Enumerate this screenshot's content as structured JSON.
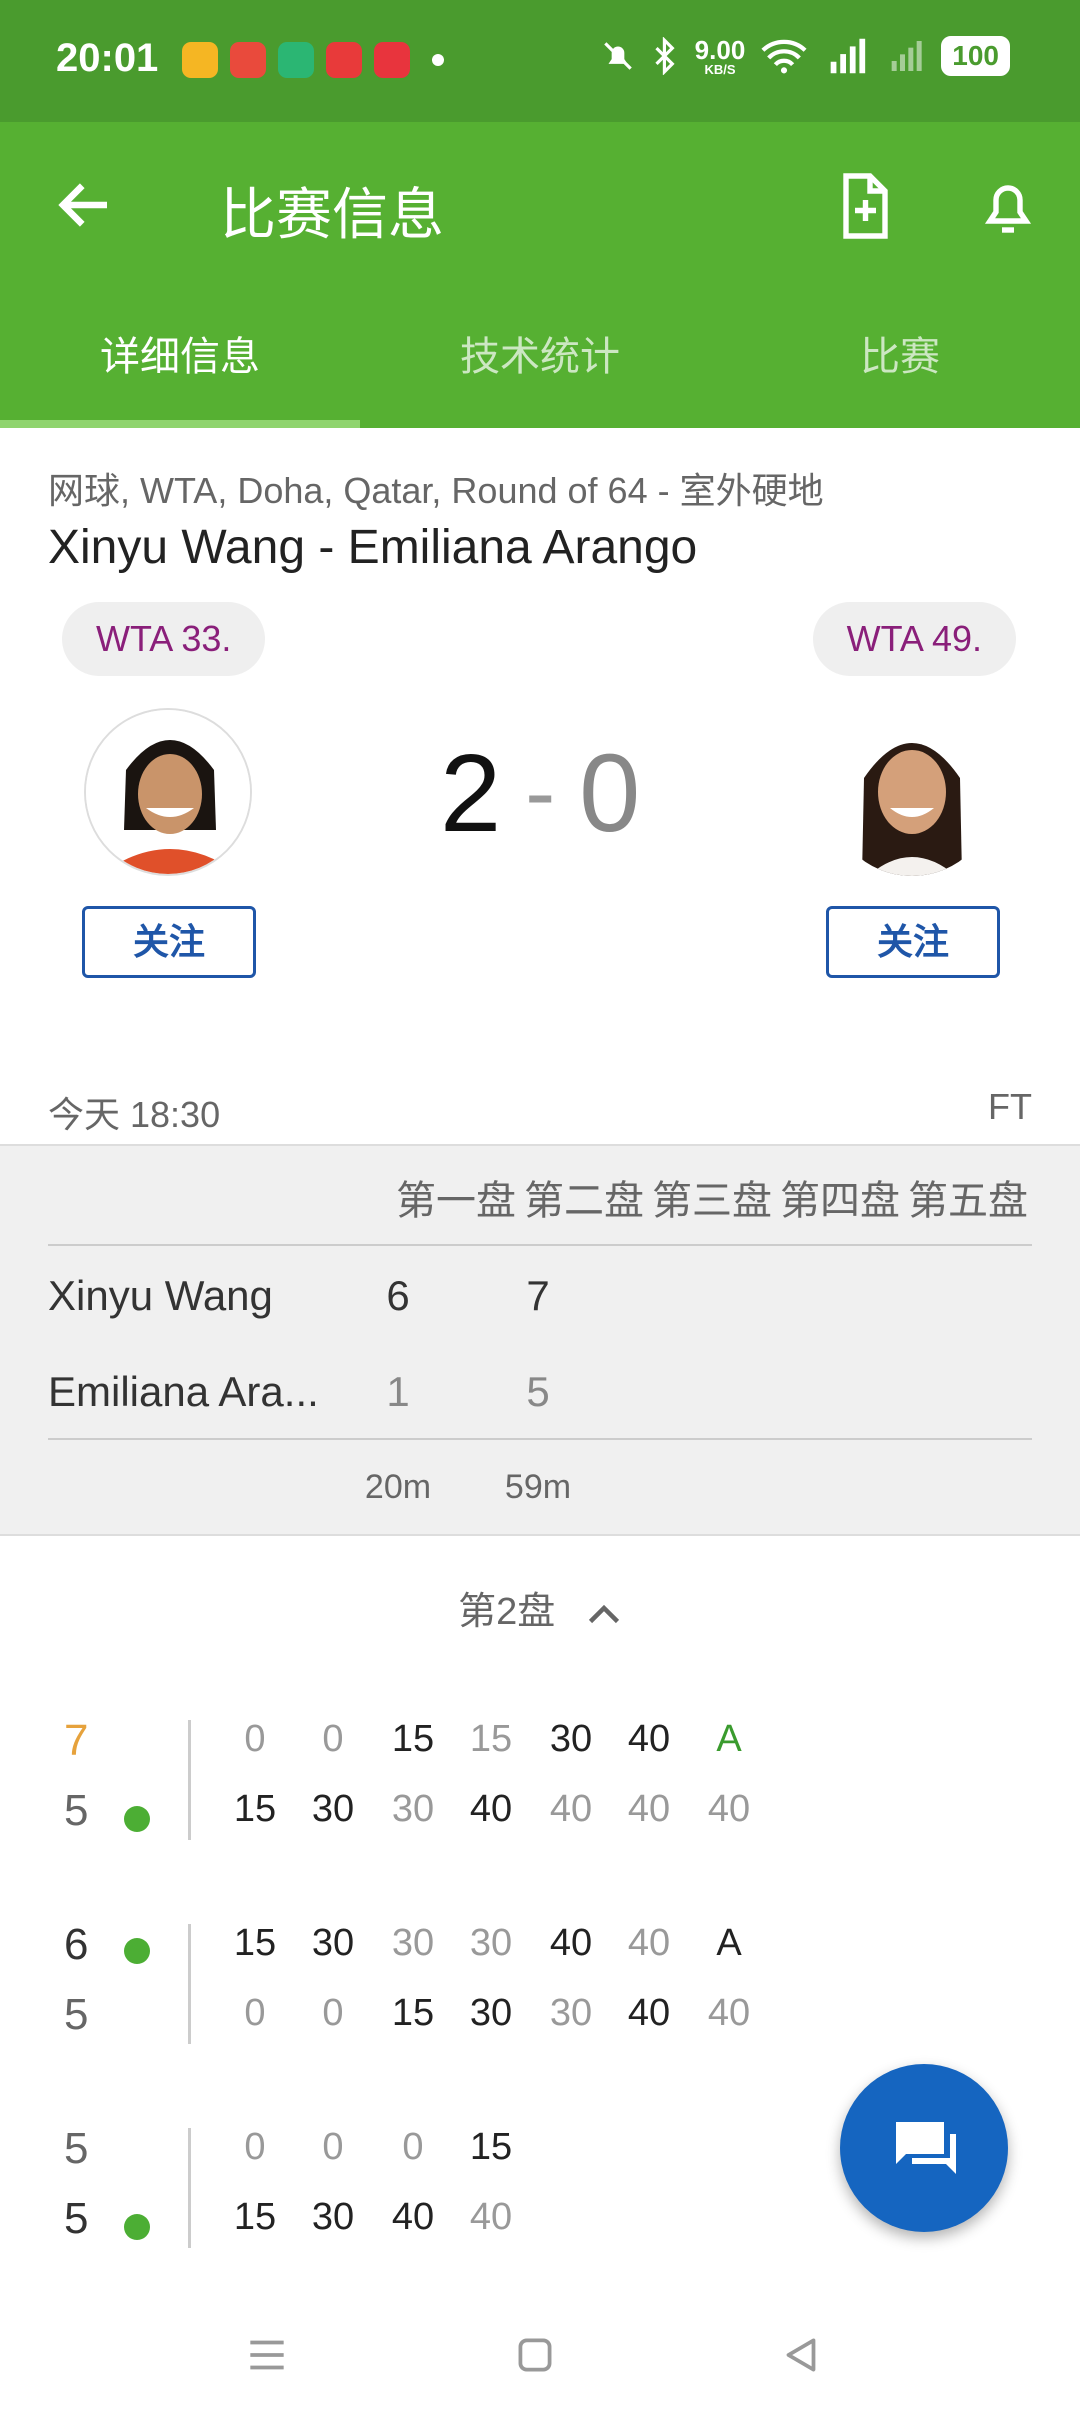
{
  "status_bar": {
    "time": "20:01",
    "net_speed_value": "9.00",
    "net_speed_unit": "KB/S",
    "battery": "100",
    "colors": {
      "bg": "#4a9b2e"
    }
  },
  "app_bar": {
    "title": "比赛信息",
    "back_icon": "arrow-left-icon",
    "add_doc_icon": "document-add-icon",
    "bell_icon": "bell-icon"
  },
  "tabs": [
    {
      "label": "详细信息",
      "active": true
    },
    {
      "label": "技术统计",
      "active": false
    },
    {
      "label": "比赛",
      "active": false
    }
  ],
  "match": {
    "meta": "网球, WTA, Doha, Qatar, Round of 64 - 室外硬地",
    "title": "Xinyu Wang - Emiliana Arango",
    "home": {
      "rank": "WTA 33.",
      "follow": "关注",
      "sets_won": "2"
    },
    "away": {
      "rank": "WTA 49.",
      "follow": "关注",
      "sets_won": "0"
    },
    "score_sep": "-",
    "time": "今天 18:30",
    "status": "FT"
  },
  "sets_table": {
    "headers": [
      "第一盘",
      "第二盘",
      "第三盘",
      "第四盘",
      "第五盘"
    ],
    "rows": [
      {
        "name": "Xinyu Wang",
        "sets": [
          "6",
          "7"
        ]
      },
      {
        "name": "Emiliana Ara...",
        "sets": [
          "1",
          "5"
        ]
      }
    ],
    "durations": [
      "20m",
      "59m"
    ]
  },
  "set_detail": {
    "title": "第2盘",
    "games": [
      {
        "top": {
          "score": "7",
          "points": [
            "0",
            "0",
            "15",
            "15",
            "30",
            "40",
            "A"
          ]
        },
        "bottom": {
          "score": "5",
          "points": [
            "15",
            "30",
            "30",
            "40",
            "40",
            "40",
            "40"
          ]
        }
      },
      {
        "top": {
          "score": "6",
          "points": [
            "15",
            "30",
            "30",
            "30",
            "40",
            "40",
            "A"
          ]
        },
        "bottom": {
          "score": "5",
          "points": [
            "0",
            "0",
            "15",
            "30",
            "30",
            "40",
            "40"
          ]
        }
      },
      {
        "top": {
          "score": "5",
          "points": [
            "0",
            "0",
            "0",
            "15"
          ]
        },
        "bottom": {
          "score": "5",
          "points": [
            "15",
            "30",
            "40",
            "40"
          ]
        }
      }
    ]
  },
  "fab_icon": "chat-icon",
  "nav": {
    "menu_icon": "menu-icon",
    "home_icon": "home-icon",
    "back_icon": "back-triangle-icon"
  },
  "colors": {
    "primary_green": "#56b032",
    "rank_text": "#8a1f7a",
    "follow_blue": "#1f56a8",
    "fab_blue": "#1565c0",
    "serve_dot": "#4cae34"
  }
}
